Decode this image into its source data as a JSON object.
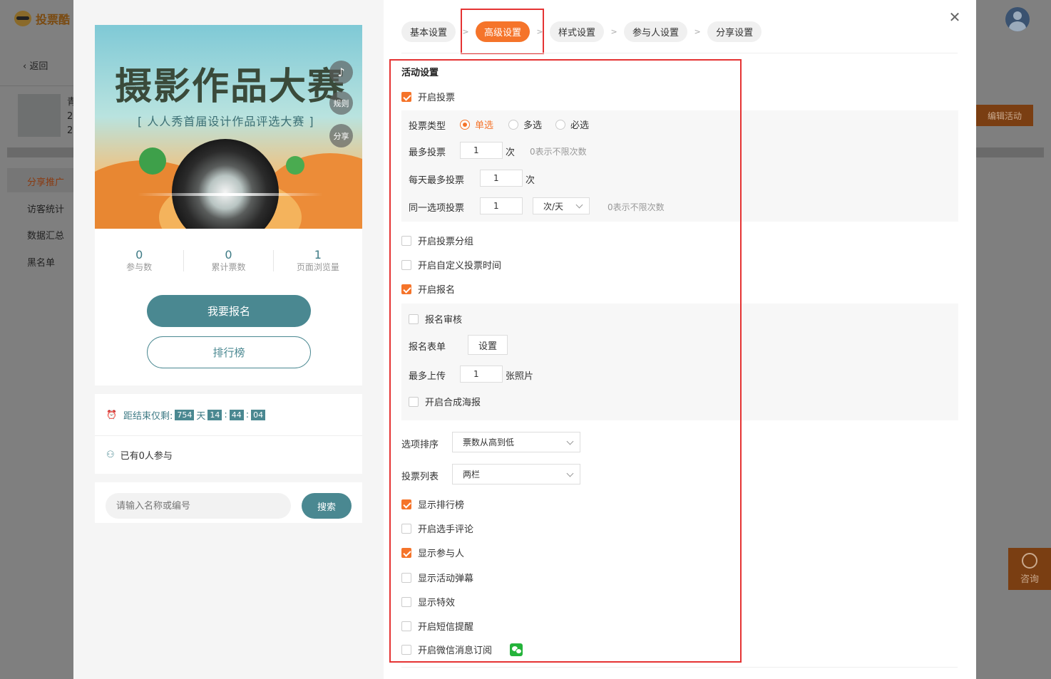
{
  "background": {
    "logo_text": "投票酷",
    "back_label": "返回",
    "thumb_lines": [
      "青",
      "2",
      "2"
    ],
    "menu": [
      "分享推广",
      "访客统计",
      "数据汇总",
      "黑名单"
    ],
    "edit_button": "编辑活动",
    "consult_label": "咨询"
  },
  "preview": {
    "banner_title": "摄影作品大赛",
    "banner_subtitle": "[ 人人秀首届设计作品评选大赛 ]",
    "fab_music": "♪",
    "fab_rules": "规则",
    "fab_share": "分享",
    "stats": [
      {
        "value": "0",
        "label": "参与数"
      },
      {
        "value": "0",
        "label": "累计票数"
      },
      {
        "value": "1",
        "label": "页面浏览量"
      }
    ],
    "signup_button": "我要报名",
    "ranking_button": "排行榜",
    "countdown": {
      "prefix": "距结束仅剩:",
      "days": "754",
      "days_unit": "天",
      "hours": "14",
      "minutes": "44",
      "seconds": "04",
      "sep": ":"
    },
    "participants_text": "已有0人参与",
    "search_placeholder": "请输入名称或编号",
    "search_button": "搜索"
  },
  "steps": [
    "基本设置",
    "高级设置",
    "样式设置",
    "参与人设置",
    "分享设置"
  ],
  "step_sep": ">",
  "active_step": 1,
  "settings": {
    "section_title": "活动设置",
    "enable_vote": {
      "label": "开启投票",
      "checked": true
    },
    "vote_type": {
      "label": "投票类型",
      "options": [
        "单选",
        "多选",
        "必选"
      ],
      "selected": 0
    },
    "max_votes": {
      "label": "最多投票",
      "value": "1",
      "unit": "次",
      "hint": "0表示不限次数"
    },
    "daily_max_votes": {
      "label": "每天最多投票",
      "value": "1",
      "unit": "次"
    },
    "same_option_votes": {
      "label": "同一选项投票",
      "value": "1",
      "unit_select": "次/天",
      "hint": "0表示不限次数"
    },
    "vote_grouping": {
      "label": "开启投票分组",
      "checked": false
    },
    "custom_vote_time": {
      "label": "开启自定义投票时间",
      "checked": false
    },
    "enable_signup": {
      "label": "开启报名",
      "checked": true
    },
    "signup_review": {
      "label": "报名审核",
      "checked": false
    },
    "signup_form": {
      "label": "报名表单",
      "button": "设置"
    },
    "max_upload": {
      "label": "最多上传",
      "value": "1",
      "unit": "张照片"
    },
    "poster": {
      "label": "开启合成海报",
      "checked": false
    },
    "option_sort": {
      "label": "选项排序",
      "value": "票数从高到低"
    },
    "vote_list": {
      "label": "投票列表",
      "value": "两栏"
    },
    "show_ranking": {
      "label": "显示排行榜",
      "checked": true
    },
    "player_comments": {
      "label": "开启选手评论",
      "checked": false
    },
    "show_participants": {
      "label": "显示参与人",
      "checked": true
    },
    "activity_danmaku": {
      "label": "显示活动弹幕",
      "checked": false
    },
    "show_effects": {
      "label": "显示特效",
      "checked": false
    },
    "sms_reminder": {
      "label": "开启短信提醒",
      "checked": false
    },
    "wechat_subscribe": {
      "label": "开启微信消息订阅",
      "checked": false
    }
  },
  "colors": {
    "accent": "#f5742a",
    "teal": "#4a8891",
    "highlight": "#e53333"
  }
}
